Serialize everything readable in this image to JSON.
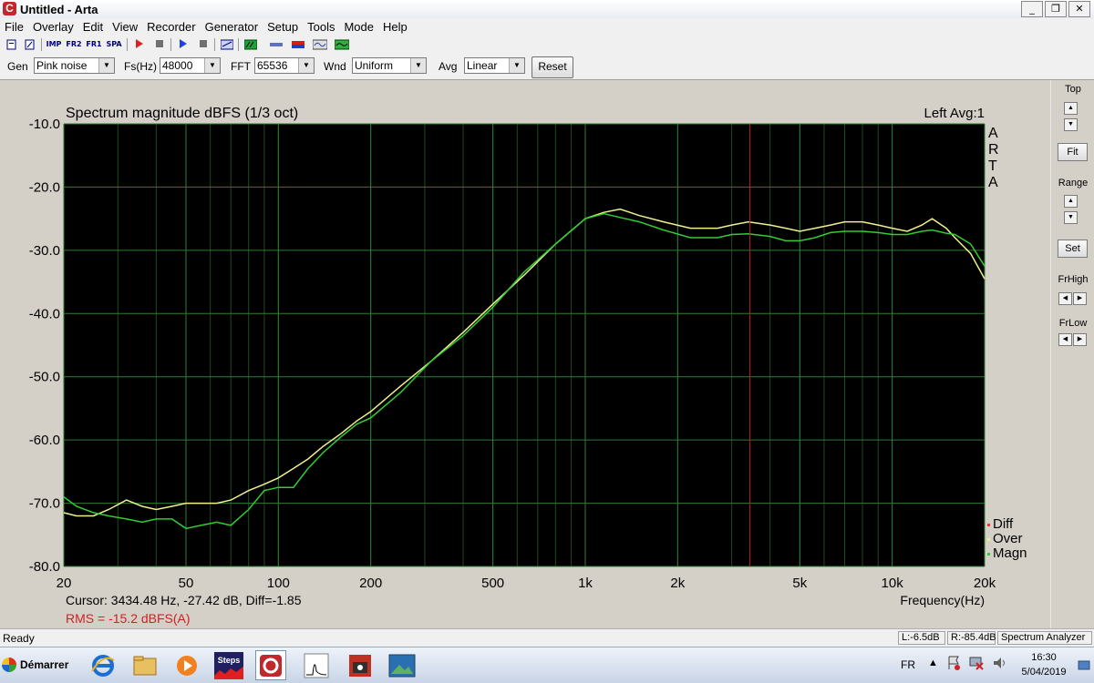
{
  "window": {
    "title": "Untitled - Arta"
  },
  "menu": [
    "File",
    "Overlay",
    "Edit",
    "View",
    "Recorder",
    "Generator",
    "Setup",
    "Tools",
    "Mode",
    "Help"
  ],
  "toolbar": {
    "imp": "IMP",
    "fr2": "FR2",
    "fr1": "FR1",
    "spa": "SPA"
  },
  "params": {
    "gen_label": "Gen",
    "gen_value": "Pink noise",
    "fs_label": "Fs(Hz)",
    "fs_value": "48000",
    "fft_label": "FFT",
    "fft_value": "65536",
    "wnd_label": "Wnd",
    "wnd_value": "Uniform",
    "avg_label": "Avg",
    "avg_value": "Linear",
    "reset_label": "Reset"
  },
  "graph": {
    "title": "Spectrum magnitude dBFS (1/3 oct)",
    "channel_info": "Left  Avg:1",
    "watermark": [
      "A",
      "R",
      "T",
      "A"
    ],
    "cursor_text": "Cursor:  3434.48 Hz, -27.42 dB,  Diff=-1.85",
    "rms_text": "RMS =  -15.2 dBFS(A)",
    "xlabel": "Frequency(Hz)",
    "cursor_freq": 3434.48,
    "colors": {
      "bg": "#000000",
      "grid": "#2e7d32",
      "magn": "#33cc33",
      "over": "#f0f090",
      "diff": "#ff3030",
      "cursor": "#c02020",
      "rms": "#d02020"
    }
  },
  "chart_data": {
    "type": "line",
    "title": "Spectrum magnitude dBFS (1/3 oct)",
    "xlabel": "Frequency(Hz)",
    "ylabel": "",
    "xscale": "log",
    "xlim": [
      20,
      20000
    ],
    "ylim": [
      -80,
      -10
    ],
    "xticks": [
      20,
      50,
      100,
      200,
      500,
      1000,
      2000,
      5000,
      10000,
      20000
    ],
    "xtick_labels": [
      "20",
      "50",
      "100",
      "200",
      "500",
      "1k",
      "2k",
      "5k",
      "10k",
      "20k"
    ],
    "yticks": [
      -10,
      -20,
      -30,
      -40,
      -50,
      -60,
      -70,
      -80
    ],
    "ytick_labels": [
      "-10.0",
      "-20.0",
      "-30.0",
      "-40.0",
      "-50.0",
      "-60.0",
      "-70.0",
      "-80.0"
    ],
    "grid": true,
    "legend": {
      "placement": "bottom-right",
      "entries": [
        {
          "name": "Diff",
          "color": "#ff3030"
        },
        {
          "name": "Over",
          "color": "#f0f090"
        },
        {
          "name": "Magn",
          "color": "#33cc33"
        }
      ]
    },
    "series": [
      {
        "name": "Over",
        "color": "#f0f090",
        "x": [
          20,
          22,
          25,
          28,
          32,
          36,
          40,
          45,
          50,
          56,
          63,
          70,
          80,
          90,
          100,
          112,
          125,
          140,
          160,
          180,
          200,
          250,
          315,
          400,
          500,
          630,
          800,
          1000,
          1150,
          1300,
          1500,
          1800,
          2200,
          2700,
          3000,
          3400,
          4000,
          4500,
          5000,
          5600,
          6300,
          7000,
          8000,
          9000,
          10000,
          11200,
          12500,
          13500,
          15000,
          16000,
          18000,
          20000
        ],
        "y": [
          -71.5,
          -72,
          -72,
          -71,
          -69.5,
          -70.5,
          -71,
          -70.5,
          -70,
          -70,
          -70,
          -69.5,
          -68,
          -67,
          -66,
          -64.5,
          -63,
          -61,
          -59,
          -57,
          -55.5,
          -51.5,
          -47.5,
          -43,
          -38.5,
          -34,
          -29,
          -25,
          -24,
          -23.5,
          -24.5,
          -25.5,
          -26.5,
          -26.5,
          -26,
          -25.5,
          -26,
          -26.5,
          -27,
          -26.5,
          -26,
          -25.5,
          -25.5,
          -26,
          -26.5,
          -27,
          -26,
          -25,
          -26.5,
          -28,
          -30.5,
          -34.5
        ]
      },
      {
        "name": "Magn",
        "color": "#33cc33",
        "x": [
          20,
          22,
          25,
          28,
          32,
          36,
          40,
          45,
          50,
          56,
          63,
          70,
          80,
          90,
          100,
          112,
          125,
          140,
          160,
          180,
          200,
          250,
          315,
          400,
          500,
          630,
          800,
          1000,
          1150,
          1300,
          1500,
          1800,
          2200,
          2700,
          3000,
          3400,
          4000,
          4500,
          5000,
          5600,
          6300,
          7000,
          8000,
          9000,
          10000,
          11200,
          12500,
          13500,
          15000,
          16000,
          18000,
          20000
        ],
        "y": [
          -69,
          -70.5,
          -71.5,
          -72,
          -72.5,
          -73,
          -72.5,
          -72.5,
          -74,
          -73.5,
          -73,
          -73.5,
          -71,
          -68,
          -67.5,
          -67.5,
          -64.5,
          -62,
          -59.5,
          -57.5,
          -56.5,
          -52.5,
          -47.5,
          -43.5,
          -39,
          -33.5,
          -29,
          -25,
          -24.2,
          -24.8,
          -25.5,
          -26.8,
          -28,
          -28,
          -27.5,
          -27.4,
          -27.8,
          -28.5,
          -28.5,
          -28,
          -27.2,
          -27,
          -27,
          -27.2,
          -27.5,
          -27.5,
          -27,
          -26.8,
          -27.3,
          -27.5,
          -29,
          -32.5
        ]
      }
    ]
  },
  "side": {
    "top": "Top",
    "fit": "Fit",
    "range": "Range",
    "set": "Set",
    "frhigh": "FrHigh",
    "frlow": "FrLow"
  },
  "status": {
    "text": "Ready",
    "left": "L:-6.5dB",
    "right": "R:-85.4dB",
    "mode": "Spectrum Analyzer"
  },
  "taskbar": {
    "start": "Démarrer",
    "steps": "Steps",
    "lang": "FR",
    "time": "16:30",
    "date": "5/04/2019"
  }
}
